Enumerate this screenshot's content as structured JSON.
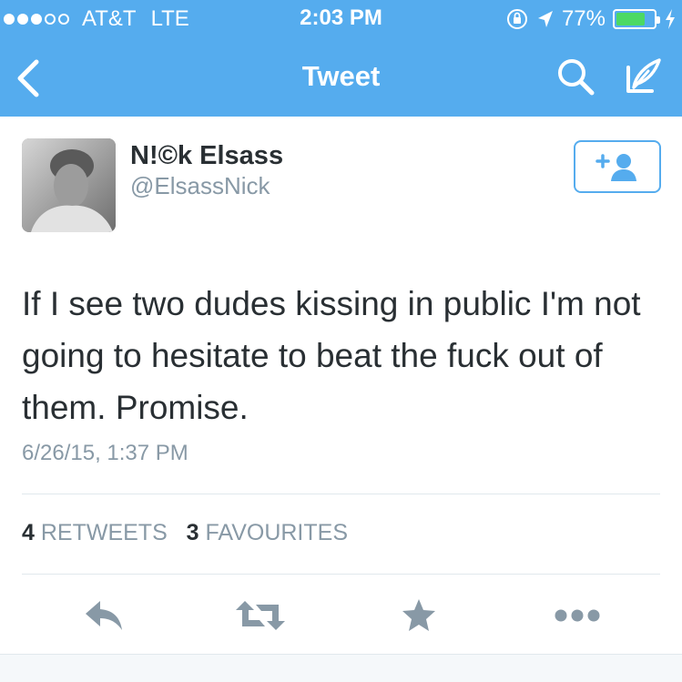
{
  "status_bar": {
    "carrier": "AT&T",
    "network": "LTE",
    "time": "2:03 PM",
    "battery": "77%",
    "battery_level": 0.77,
    "signal_bars_filled": 3,
    "signal_bars_total": 5
  },
  "nav": {
    "title": "Tweet",
    "back_icon": "chevron-left-icon",
    "search_icon": "search-icon",
    "compose_icon": "compose-icon"
  },
  "tweet": {
    "author_name": "N!©k Elsass",
    "author_handle": "@ElsassNick",
    "text": "If I see two dudes kissing in public I'm not going to hesitate to beat the fuck out of them. Promise.",
    "timestamp": "6/26/15, 1:37 PM"
  },
  "stats": {
    "retweets_count": "4",
    "retweets_label": "RETWEETS",
    "favourites_count": "3",
    "favourites_label": "FAVOURITES"
  },
  "colors": {
    "brand": "#55acee",
    "text": "#292f33",
    "muted": "#8899a6",
    "action": "#8899a6",
    "battery_fill": "#4cd964"
  }
}
